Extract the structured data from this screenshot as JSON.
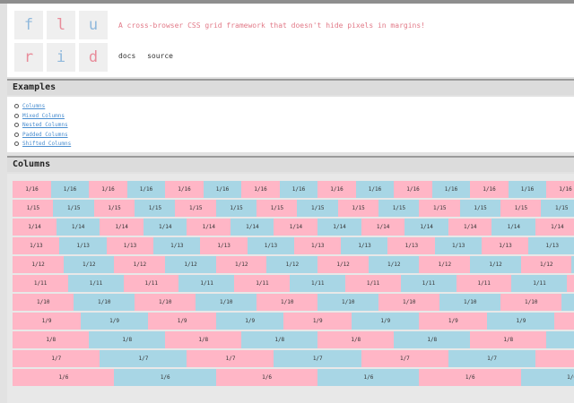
{
  "header": {
    "logo": [
      {
        "letter": "f",
        "color": "#8fb8dc"
      },
      {
        "letter": "l",
        "color": "#e88c9a"
      },
      {
        "letter": "u",
        "color": "#8fb8dc"
      },
      {
        "letter": "r",
        "color": "#e88c9a"
      },
      {
        "letter": "i",
        "color": "#8fb8dc"
      },
      {
        "letter": "d",
        "color": "#e88c9a"
      }
    ],
    "tagline": "A cross-browser CSS grid framework that doesn't hide pixels in margins!",
    "nav": [
      "docs",
      "source"
    ]
  },
  "examples": {
    "title": "Examples",
    "links": [
      "Columns",
      "Mixed Columns",
      "Nested Columns",
      "Padded Columns",
      "Shifted Columns"
    ]
  },
  "columns": {
    "title": "Columns",
    "colors": {
      "pink": "#ffb6c6",
      "blue": "#a8d6e5"
    },
    "rows": [
      {
        "label": "1/16",
        "count": 16
      },
      {
        "label": "1/15",
        "count": 15
      },
      {
        "label": "1/14",
        "count": 14
      },
      {
        "label": "1/13",
        "count": 13
      },
      {
        "label": "1/12",
        "count": 12
      },
      {
        "label": "1/11",
        "count": 11
      },
      {
        "label": "1/10",
        "count": 10
      },
      {
        "label": "1/9",
        "count": 9
      },
      {
        "label": "1/8",
        "count": 8
      },
      {
        "label": "1/7",
        "count": 7
      },
      {
        "label": "1/6",
        "count": 6
      }
    ]
  }
}
